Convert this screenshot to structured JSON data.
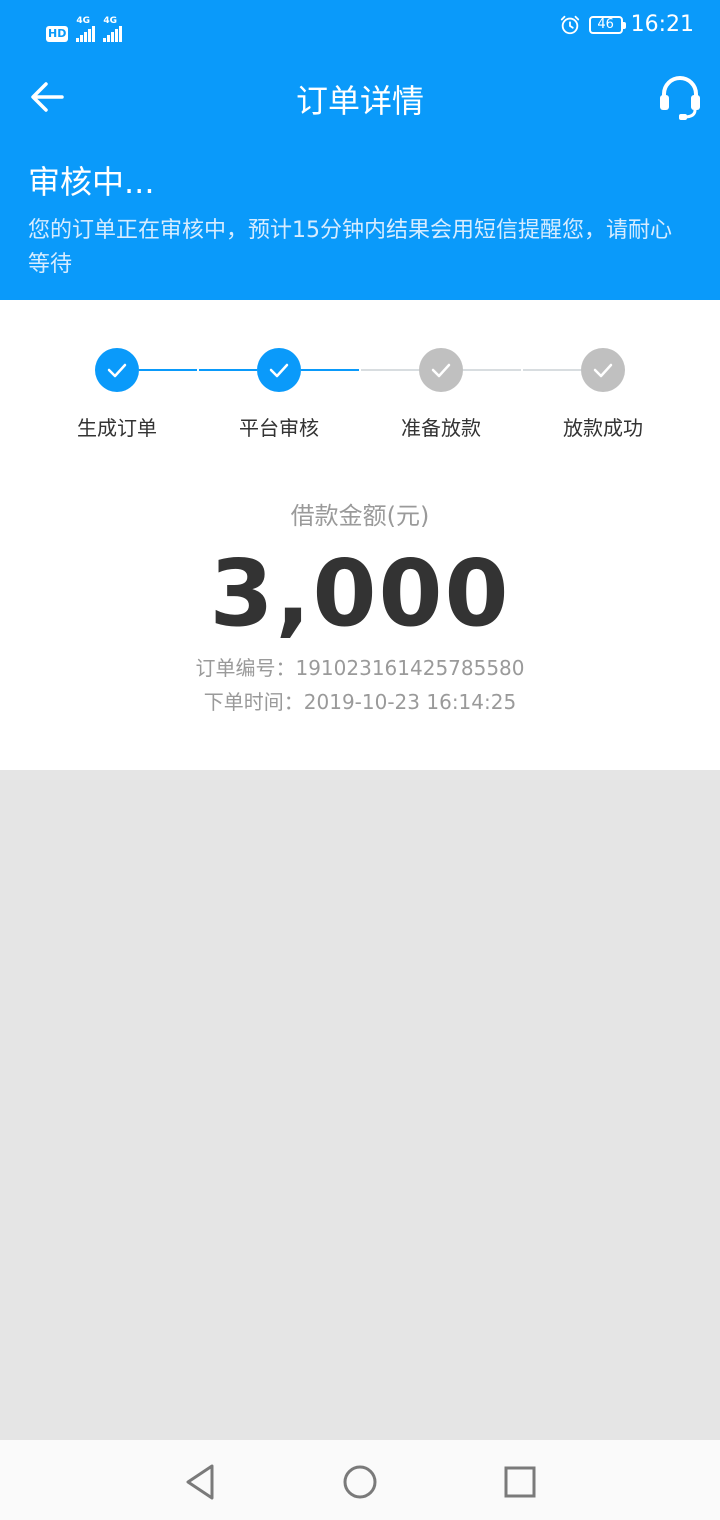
{
  "status_bar": {
    "hd_badge": "HD",
    "signal1_label": "4G",
    "signal2_label": "4G",
    "battery": "46",
    "time": "16:21"
  },
  "header": {
    "title": "订单详情"
  },
  "order_status": {
    "title": "审核中...",
    "description": "您的订单正在审核中，预计15分钟内结果会用短信提醒您，请耐心等待"
  },
  "steps": [
    {
      "label": "生成订单",
      "done": true
    },
    {
      "label": "平台审核",
      "done": true
    },
    {
      "label": "准备放款",
      "done": false
    },
    {
      "label": "放款成功",
      "done": false
    }
  ],
  "loan": {
    "amount_label": "借款金额(元)",
    "amount": "3,000",
    "order_number_line": "订单编号：191023161425785580",
    "order_time_line": "下单时间：2019-10-23 16:14:25"
  },
  "colors": {
    "primary": "#0a9afa",
    "step_inactive": "#c0c0c0",
    "page_background": "#e5e5e5"
  }
}
